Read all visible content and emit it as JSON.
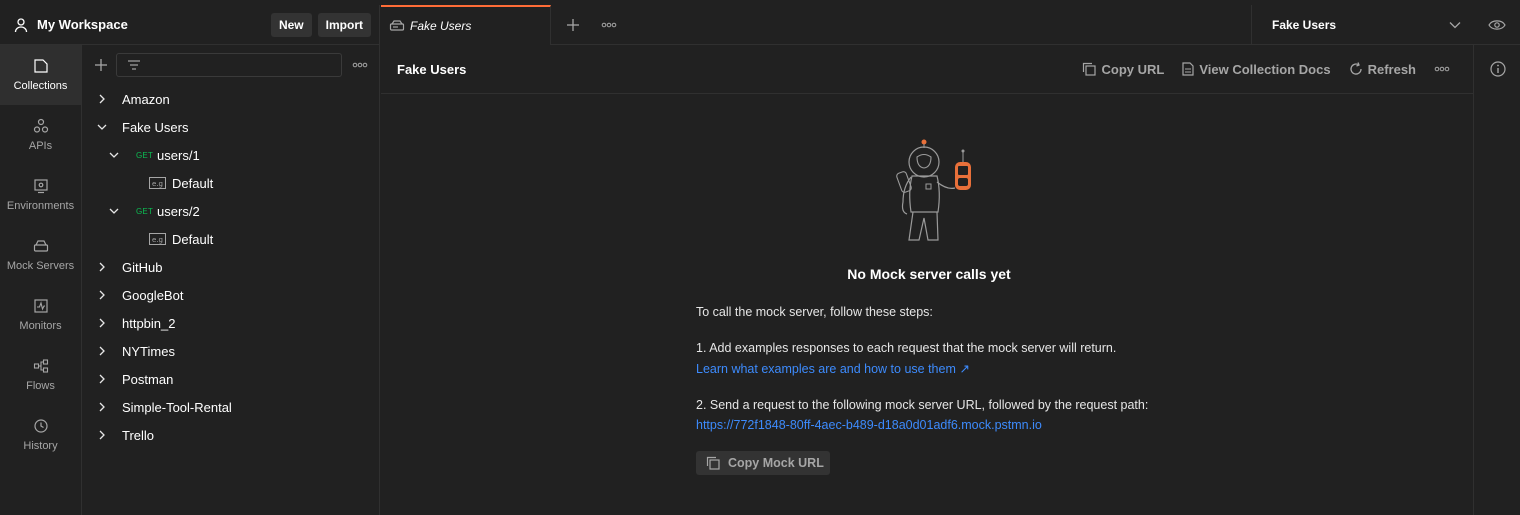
{
  "workspace": {
    "title": "My Workspace",
    "new_label": "New",
    "import_label": "Import"
  },
  "tabs": [
    {
      "label": "Fake Users"
    }
  ],
  "environment": {
    "selected": "Fake Users"
  },
  "rail": [
    {
      "label": "Collections",
      "icon": "collections-icon"
    },
    {
      "label": "APIs",
      "icon": "apis-icon"
    },
    {
      "label": "Environments",
      "icon": "environments-icon"
    },
    {
      "label": "Mock Servers",
      "icon": "mock-servers-icon"
    },
    {
      "label": "Monitors",
      "icon": "monitors-icon"
    },
    {
      "label": "Flows",
      "icon": "flows-icon"
    },
    {
      "label": "History",
      "icon": "history-icon"
    }
  ],
  "tree": {
    "amazon": "Amazon",
    "fake_users": "Fake Users",
    "req1_method": "GET",
    "req1_name": "users/1",
    "req1_example": "Default",
    "req2_method": "GET",
    "req2_name": "users/2",
    "req2_example": "Default",
    "github": "GitHub",
    "googlebot": "GoogleBot",
    "httpbin": "httpbin_2",
    "nytimes": "NYTimes",
    "postman": "Postman",
    "simple_tool": "Simple-Tool-Rental",
    "trello": "Trello"
  },
  "main": {
    "title": "Fake Users",
    "copy_url": "Copy URL",
    "view_docs": "View Collection Docs",
    "refresh": "Refresh",
    "heading": "No Mock server calls yet",
    "intro": "To call the mock server, follow these steps:",
    "step1": "1. Add examples responses to each request that the mock server will return.",
    "step1_link": "Learn what examples are and how to use them ↗",
    "step2": "2. Send a request to the following mock server URL, followed by the request path:",
    "mock_url": "https://772f1848-80ff-4aec-b489-d18a0d01adf6.mock.pstmn.io",
    "copy_mock_url": "Copy Mock URL"
  },
  "colors": {
    "accent": "#ff6c37",
    "link": "#3d8bfd",
    "get_method": "#0cbb52",
    "background": "#212121"
  }
}
